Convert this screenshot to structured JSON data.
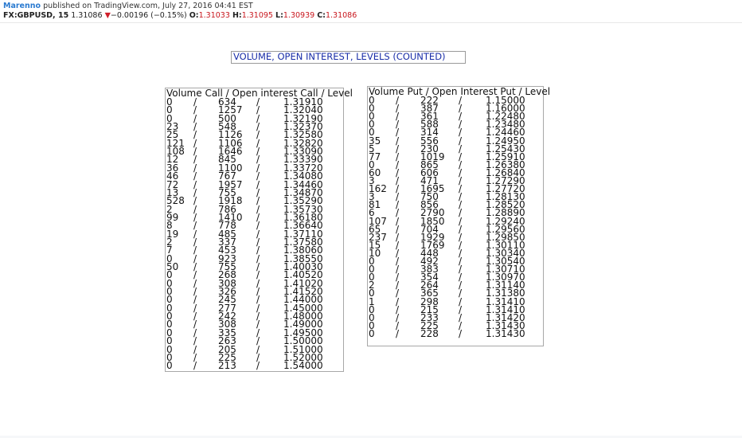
{
  "header": {
    "author": "Marenno",
    "published_text": "published on TradingView.com, July 27, 2016 04:41 EST",
    "symbol": "FX:GBPUSD, 15",
    "price": "1.31086",
    "change": "−0.00196 (−0.15%)",
    "open_label": "O:",
    "open": "1.31033",
    "high_label": "H:",
    "high": "1.31095",
    "low_label": "L:",
    "low": "1.30939",
    "close_label": "C:",
    "close": "1.31086",
    "colors": {
      "author": "#2a7ad0",
      "down": "#d01f2a",
      "ohlc": "#c8161d",
      "title": "#1a2ea8"
    }
  },
  "title": "VOLUME, OPEN INTEREST, LEVELS (COUNTED)",
  "call_panel": {
    "heading": "Volume Call / Open interest Call / Level",
    "rows": [
      [
        "0",
        "634",
        "1.31910"
      ],
      [
        "0",
        "1257",
        "1.32040"
      ],
      [
        "0",
        "500",
        "1.32190"
      ],
      [
        "23",
        "548",
        "1.32370"
      ],
      [
        "25",
        "1126",
        "1.32580"
      ],
      [
        "121",
        "1106",
        "1.32820"
      ],
      [
        "108",
        "1646",
        "1.33090"
      ],
      [
        "12",
        "845",
        "1.33390"
      ],
      [
        "36",
        "1100",
        "1.33720"
      ],
      [
        "46",
        "767",
        "1.34080"
      ],
      [
        "72",
        "1957",
        "1.34460"
      ],
      [
        "13",
        "755",
        "1.34870"
      ],
      [
        "528",
        "1918",
        "1.35290"
      ],
      [
        "2",
        "786",
        "1.35730"
      ],
      [
        "99",
        "1410",
        "1.36180"
      ],
      [
        "8",
        "778",
        "1.36640"
      ],
      [
        "19",
        "485",
        "1.37110"
      ],
      [
        "2",
        "337",
        "1.37580"
      ],
      [
        "7",
        "453",
        "1.38060"
      ],
      [
        "0",
        "923",
        "1.38550"
      ],
      [
        "50",
        "755",
        "1.40030"
      ],
      [
        "0",
        "268",
        "1.40520"
      ],
      [
        "0",
        "308",
        "1.41020"
      ],
      [
        "0",
        "326",
        "1.41520"
      ],
      [
        "0",
        "245",
        "1.44000"
      ],
      [
        "0",
        "277",
        "1.45000"
      ],
      [
        "0",
        "242",
        "1.48000"
      ],
      [
        "0",
        "308",
        "1.49000"
      ],
      [
        "0",
        "335",
        "1.49500"
      ],
      [
        "0",
        "263",
        "1.50000"
      ],
      [
        "0",
        "205",
        "1.51000"
      ],
      [
        "0",
        "225",
        "1.52000"
      ],
      [
        "0",
        "213",
        "1.54000"
      ]
    ]
  },
  "put_panel": {
    "heading": "Volume Put / Open Interest Put / Level",
    "rows": [
      [
        "0",
        "222",
        "1.15000"
      ],
      [
        "0",
        "387",
        "1.16000"
      ],
      [
        "0",
        "361",
        "1.22480"
      ],
      [
        "0",
        "588",
        "1.23480"
      ],
      [
        "0",
        "314",
        "1.24460"
      ],
      [
        "35",
        "556",
        "1.24950"
      ],
      [
        "5",
        "230",
        "1.25430"
      ],
      [
        "77",
        "1019",
        "1.25910"
      ],
      [
        "0",
        "865",
        "1.26380"
      ],
      [
        "60",
        "606",
        "1.26840"
      ],
      [
        "3",
        "471",
        "1.27290"
      ],
      [
        "162",
        "1695",
        "1.27720"
      ],
      [
        "3",
        "750",
        "1.28130"
      ],
      [
        "81",
        "856",
        "1.28520"
      ],
      [
        "6",
        "2790",
        "1.28890"
      ],
      [
        "107",
        "1850",
        "1.29240"
      ],
      [
        "65",
        "704",
        "1.29560"
      ],
      [
        "237",
        "1929",
        "1.29850"
      ],
      [
        "15",
        "1769",
        "1.30110"
      ],
      [
        "10",
        "448",
        "1.30340"
      ],
      [
        "0",
        "492",
        "1.30540"
      ],
      [
        "0",
        "383",
        "1.30710"
      ],
      [
        "0",
        "354",
        "1.30970"
      ],
      [
        "2",
        "264",
        "1.31140"
      ],
      [
        "0",
        "365",
        "1.31380"
      ],
      [
        "1",
        "298",
        "1.31410"
      ],
      [
        "0",
        "215",
        "1.31410"
      ],
      [
        "0",
        "233",
        "1.31420"
      ],
      [
        "0",
        "225",
        "1.31430"
      ],
      [
        "0",
        "228",
        "1.31430"
      ]
    ]
  },
  "separator": "/"
}
